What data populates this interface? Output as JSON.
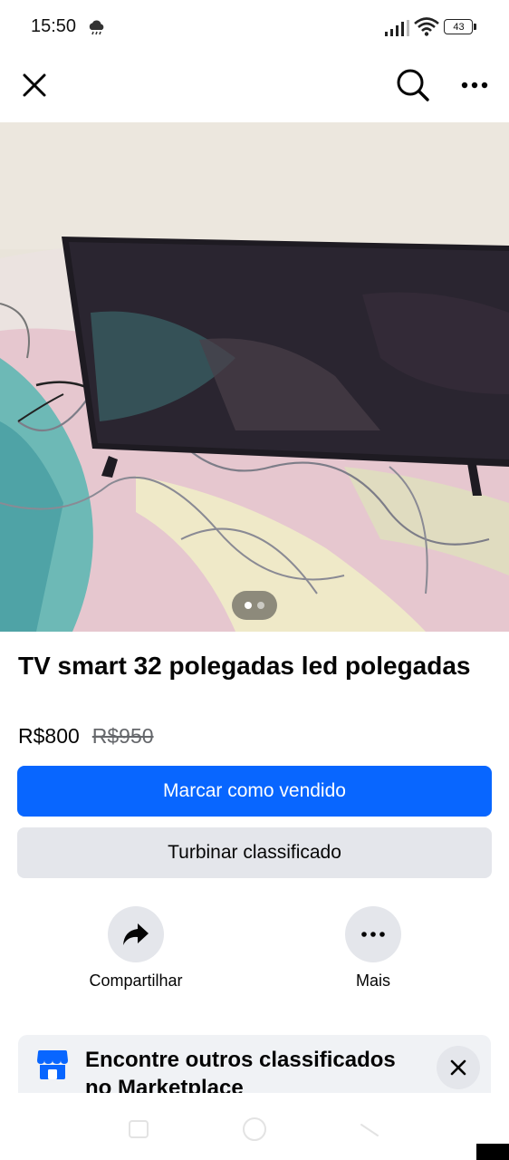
{
  "status_bar": {
    "time": "15:50",
    "battery": "43",
    "icons": [
      "weather-icon",
      "signal-icon",
      "wifi-icon",
      "battery-icon"
    ]
  },
  "nav": {
    "icons": [
      "close-icon",
      "search-icon",
      "more-icon"
    ]
  },
  "photo": {
    "description_icon": "tv-photo",
    "pages": 2,
    "current_page": 1
  },
  "listing": {
    "title": "TV smart 32 polegadas led polegadas",
    "price": "R$800",
    "old_price": "R$950"
  },
  "buttons": {
    "primary_label": "Marcar como vendido",
    "secondary_label": "Turbinar classificado"
  },
  "actions": [
    {
      "label": "Compartilhar",
      "icon": "share-icon"
    },
    {
      "label": "Mais",
      "icon": "more-icon"
    }
  ],
  "marketplace_card": {
    "text": "Encontre outros classificados no Marketplace",
    "icon": "marketplace-store-icon"
  },
  "colors": {
    "primary": "#0866ff",
    "secondary_bg": "#e4e6eb",
    "muted_text": "#65676b"
  }
}
